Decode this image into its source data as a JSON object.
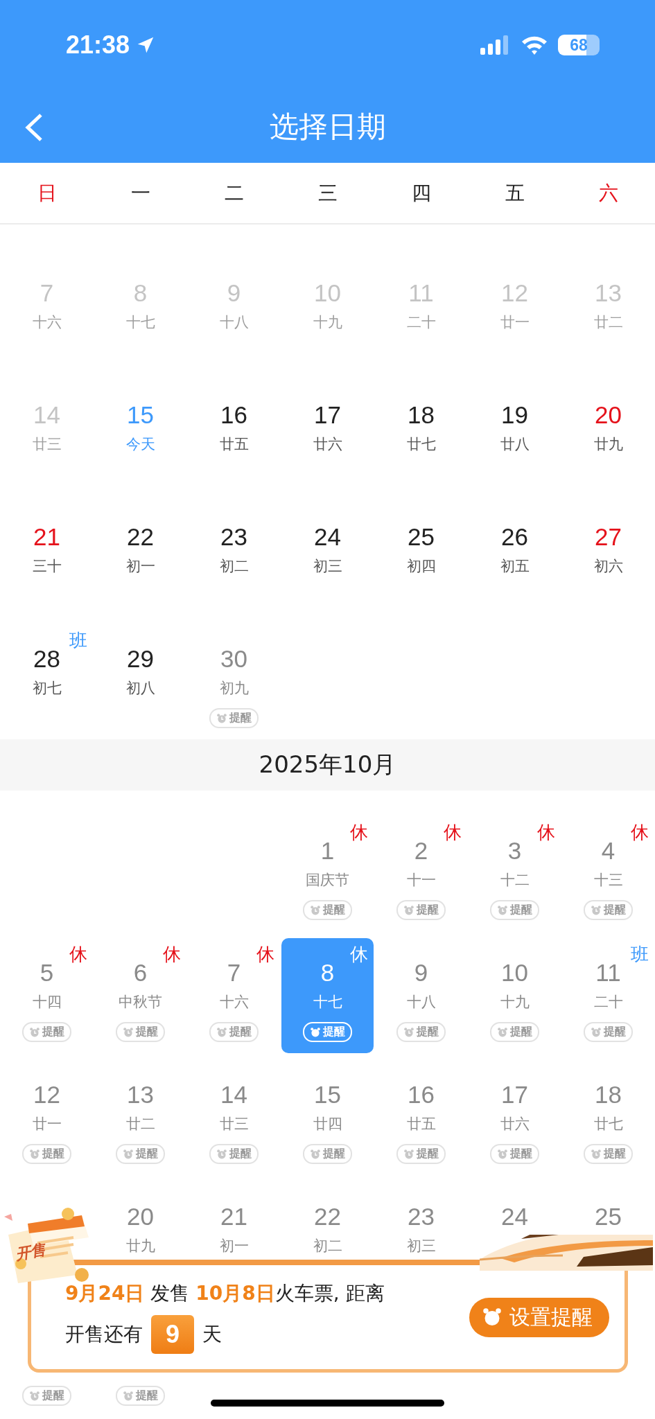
{
  "status_bar": {
    "time": "21:38",
    "battery": "68"
  },
  "header": {
    "title": "选择日期"
  },
  "weekdays": [
    {
      "label": "日",
      "weekend": true
    },
    {
      "label": "一",
      "weekend": false
    },
    {
      "label": "二",
      "weekend": false
    },
    {
      "label": "三",
      "weekend": false
    },
    {
      "label": "四",
      "weekend": false
    },
    {
      "label": "五",
      "weekend": false
    },
    {
      "label": "六",
      "weekend": true
    }
  ],
  "months": [
    {
      "weeks": [
        [
          {
            "day": "7",
            "lunar": "十六",
            "kind": "past",
            "selected": false
          },
          {
            "day": "8",
            "lunar": "十七",
            "kind": "past",
            "selected": false
          },
          {
            "day": "9",
            "lunar": "十八",
            "kind": "past",
            "selected": false
          },
          {
            "day": "10",
            "lunar": "十九",
            "kind": "past",
            "selected": false
          },
          {
            "day": "11",
            "lunar": "二十",
            "kind": "past",
            "selected": false
          },
          {
            "day": "12",
            "lunar": "廿一",
            "kind": "past",
            "selected": false
          },
          {
            "day": "13",
            "lunar": "廿二",
            "kind": "past",
            "selected": false
          }
        ],
        [
          {
            "day": "14",
            "lunar": "廿三",
            "kind": "past",
            "selected": false
          },
          {
            "day": "15",
            "lunar": "今天",
            "kind": "today",
            "selected": false
          },
          {
            "day": "16",
            "lunar": "廿五",
            "kind": "normal",
            "selected": false
          },
          {
            "day": "17",
            "lunar": "廿六",
            "kind": "normal",
            "selected": false
          },
          {
            "day": "18",
            "lunar": "廿七",
            "kind": "normal",
            "selected": false
          },
          {
            "day": "19",
            "lunar": "廿八",
            "kind": "normal",
            "selected": false
          },
          {
            "day": "20",
            "lunar": "廿九",
            "kind": "weekend",
            "selected": false
          }
        ],
        [
          {
            "day": "21",
            "lunar": "三十",
            "kind": "weekend",
            "selected": false
          },
          {
            "day": "22",
            "lunar": "初一",
            "kind": "normal",
            "selected": false
          },
          {
            "day": "23",
            "lunar": "初二",
            "kind": "normal",
            "selected": false
          },
          {
            "day": "24",
            "lunar": "初三",
            "kind": "normal",
            "selected": false
          },
          {
            "day": "25",
            "lunar": "初四",
            "kind": "normal",
            "selected": false
          },
          {
            "day": "26",
            "lunar": "初五",
            "kind": "normal",
            "selected": false
          },
          {
            "day": "27",
            "lunar": "初六",
            "kind": "weekend",
            "selected": false
          }
        ],
        [
          {
            "day": "28",
            "lunar": "初七",
            "kind": "normal",
            "tag": {
              "text": "班",
              "color": "#3d99fb"
            },
            "selected": false
          },
          {
            "day": "29",
            "lunar": "初八",
            "kind": "normal",
            "selected": false
          },
          {
            "day": "30",
            "lunar": "初九",
            "kind": "upcoming",
            "remind": "提醒",
            "selected": false
          }
        ]
      ]
    },
    {
      "heading": "2025年10月",
      "weeks": [
        [
          {
            "kind": "blank"
          },
          {
            "kind": "blank"
          },
          {
            "kind": "blank"
          },
          {
            "day": "1",
            "lunar": "国庆节",
            "kind": "upcoming",
            "tag": {
              "text": "休",
              "color": "#e5121b"
            },
            "remind": "提醒",
            "selected": false
          },
          {
            "day": "2",
            "lunar": "十一",
            "kind": "upcoming",
            "tag": {
              "text": "休",
              "color": "#e5121b"
            },
            "remind": "提醒",
            "selected": false
          },
          {
            "day": "3",
            "lunar": "十二",
            "kind": "upcoming",
            "tag": {
              "text": "休",
              "color": "#e5121b"
            },
            "remind": "提醒",
            "selected": false
          },
          {
            "day": "4",
            "lunar": "十三",
            "kind": "upcoming",
            "tag": {
              "text": "休",
              "color": "#e5121b"
            },
            "remind": "提醒",
            "selected": false
          }
        ],
        [
          {
            "day": "5",
            "lunar": "十四",
            "kind": "upcoming",
            "tag": {
              "text": "休",
              "color": "#e5121b"
            },
            "remind": "提醒",
            "selected": false
          },
          {
            "day": "6",
            "lunar": "中秋节",
            "kind": "upcoming",
            "tag": {
              "text": "休",
              "color": "#e5121b"
            },
            "remind": "提醒",
            "selected": false
          },
          {
            "day": "7",
            "lunar": "十六",
            "kind": "upcoming",
            "tag": {
              "text": "休",
              "color": "#e5121b"
            },
            "remind": "提醒",
            "selected": false
          },
          {
            "day": "8",
            "lunar": "十七",
            "kind": "upcoming",
            "tag": {
              "text": "休",
              "color": "#ffffff"
            },
            "remind": "提醒",
            "selected": true
          },
          {
            "day": "9",
            "lunar": "十八",
            "kind": "upcoming",
            "remind": "提醒",
            "selected": false
          },
          {
            "day": "10",
            "lunar": "十九",
            "kind": "upcoming",
            "remind": "提醒",
            "selected": false
          },
          {
            "day": "11",
            "lunar": "二十",
            "kind": "upcoming",
            "tag": {
              "text": "班",
              "color": "#3d99fb"
            },
            "remind": "提醒",
            "selected": false
          }
        ],
        [
          {
            "day": "12",
            "lunar": "廿一",
            "kind": "upcoming",
            "remind": "提醒",
            "selected": false
          },
          {
            "day": "13",
            "lunar": "廿二",
            "kind": "upcoming",
            "remind": "提醒",
            "selected": false
          },
          {
            "day": "14",
            "lunar": "廿三",
            "kind": "upcoming",
            "remind": "提醒",
            "selected": false
          },
          {
            "day": "15",
            "lunar": "廿四",
            "kind": "upcoming",
            "remind": "提醒",
            "selected": false
          },
          {
            "day": "16",
            "lunar": "廿五",
            "kind": "upcoming",
            "remind": "提醒",
            "selected": false
          },
          {
            "day": "17",
            "lunar": "廿六",
            "kind": "upcoming",
            "remind": "提醒",
            "selected": false
          },
          {
            "day": "18",
            "lunar": "廿七",
            "kind": "upcoming",
            "remind": "提醒",
            "selected": false
          }
        ],
        [
          {
            "kind": "blank"
          },
          {
            "day": "20",
            "lunar": "廿九",
            "kind": "upcoming",
            "selected": false
          },
          {
            "day": "21",
            "lunar": "初一",
            "kind": "upcoming",
            "selected": false
          },
          {
            "day": "22",
            "lunar": "初二",
            "kind": "upcoming",
            "selected": false
          },
          {
            "day": "23",
            "lunar": "初三",
            "kind": "upcoming",
            "selected": false
          },
          {
            "day": "24",
            "kind": "upcoming",
            "selected": false
          },
          {
            "day": "25",
            "kind": "upcoming",
            "selected": false
          }
        ],
        [
          {
            "kind": "upcoming",
            "remind": "提醒",
            "selected": false
          },
          {
            "kind": "upcoming",
            "remind": "提醒",
            "selected": false
          }
        ]
      ]
    }
  ],
  "sale_banner": {
    "badge": "开售",
    "message": "**9月24日** 发售 **10月8日**火车票, 距离",
    "countdown_prefix": "开售还有",
    "countdown": "9",
    "countdown_suffix": "天",
    "button": "设置提醒"
  }
}
